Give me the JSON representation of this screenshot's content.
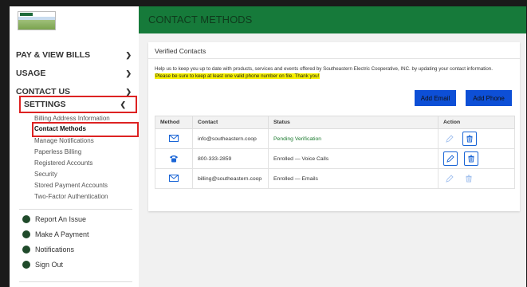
{
  "header": {
    "title": "CONTACT METHODS"
  },
  "sidebar": {
    "nav": [
      {
        "label": "PAY & VIEW BILLS"
      },
      {
        "label": "USAGE"
      },
      {
        "label": "CONTACT US"
      },
      {
        "label": "SETTINGS"
      }
    ],
    "settings_items": [
      "Billing Address Information",
      "Contact Methods",
      "Manage Notifications",
      "Paperless Billing",
      "Registered Accounts",
      "Security",
      "Stored Payment Accounts",
      "Two-Factor Authentication"
    ],
    "quick_links": [
      "Report An Issue",
      "Make A Payment",
      "Notifications",
      "Sign Out"
    ]
  },
  "main": {
    "card_title": "Verified Contacts",
    "description": "Help us to keep you up to date with products, services and events offered by Southeastern Electric Cooperative, INC. by updating your contact information.",
    "warning": "Please be sure to keep at least one valid phone number on file. Thank you!",
    "add_email_label": "Add Email",
    "add_phone_label": "Add Phone",
    "columns": [
      "Method",
      "Contact",
      "Status",
      "Action"
    ],
    "rows": [
      {
        "method_icon": "envelope-icon",
        "contact": "info@southeastern.coop",
        "status": "Pending Verification",
        "status_color": "#1a7a2e"
      },
      {
        "method_icon": "phone-icon",
        "contact": "800-333-2859",
        "status": "Enrolled — Voice Calls",
        "status_color": "#333333"
      },
      {
        "method_icon": "envelope-icon",
        "contact": "billing@southeastern.coop",
        "status": "Enrolled — Emails",
        "status_color": "#333333"
      }
    ]
  },
  "colors": {
    "accent_green": "#167a3a",
    "button_blue": "#0d4fd6",
    "highlight": "#f6f000",
    "outline_red": "#d22222"
  }
}
